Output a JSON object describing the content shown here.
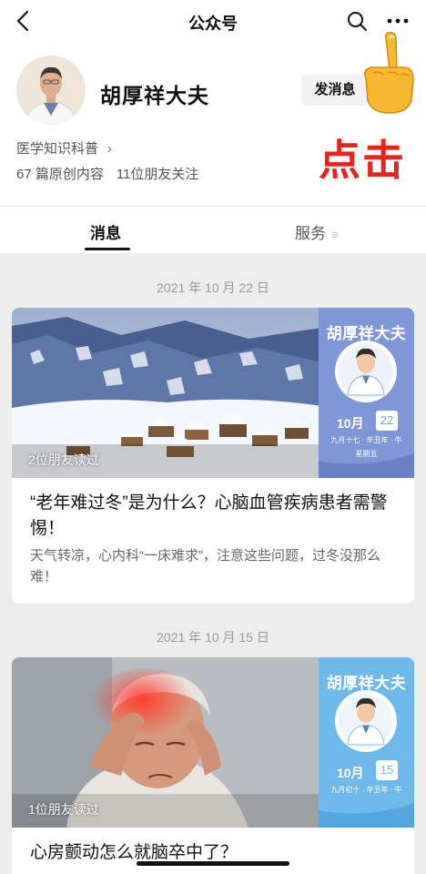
{
  "nav": {
    "title": "公众号"
  },
  "account": {
    "name": "胡厚祥大夫",
    "message_button": "发消息",
    "category": "医学知识科普",
    "original_count": "67 篇原创内容",
    "friends_follow": "11位朋友关注"
  },
  "overlay": {
    "click_label": "点击"
  },
  "tabs": [
    {
      "label": "消息",
      "active": true
    },
    {
      "label": "服务",
      "active": false
    }
  ],
  "articles": [
    {
      "date": "2021 年 10 月 22 日",
      "friends_read": "2位朋友读过",
      "title": "“老年难过冬”是为什么？心脑血管疾病患者需警惕！",
      "desc": "天气转凉，心内科“一床难求”，注意这些问题，过冬没那么难！",
      "brand": "胡厚祥大夫",
      "month": "10月",
      "day": "22",
      "lunar": "九月十七 · 辛丑年 · 牛",
      "weekday": "星期五",
      "accent": "#7f97d6"
    },
    {
      "date": "2021 年 10 月 15 日",
      "friends_read": "1位朋友读过",
      "title": "心房颤动怎么就脑卒中了？",
      "desc": "",
      "brand": "胡厚祥大夫",
      "month": "10月",
      "day": "15",
      "lunar": "九月初十 · 辛丑年 · 牛",
      "weekday": "",
      "accent": "#6fb8ea"
    }
  ],
  "colors": {
    "highlight": "#e8231f",
    "background": "#ededed"
  }
}
